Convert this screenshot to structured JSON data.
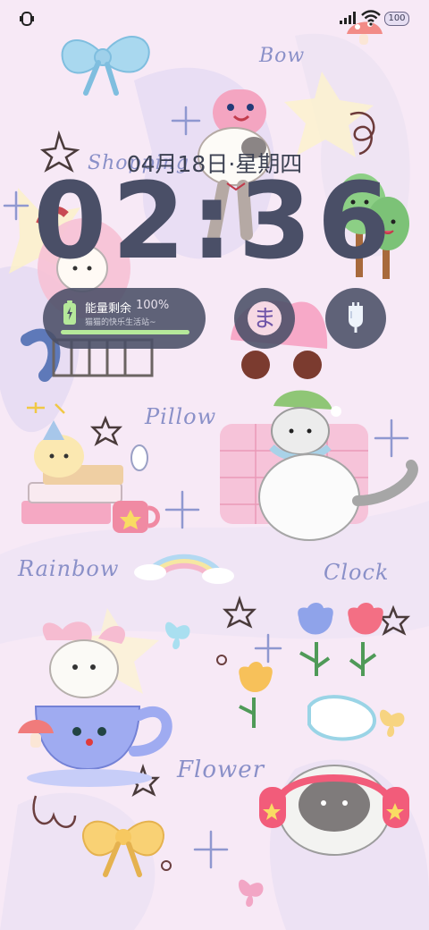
{
  "status_bar": {
    "left_icon": "notification-icon",
    "signal_icon": "signal-bars-icon",
    "wifi_icon": "wifi-icon",
    "battery_level": "100"
  },
  "lockscreen": {
    "date": "04月18日",
    "date_separator": "·",
    "weekday": "星期四",
    "time": "02:36"
  },
  "widgets": {
    "energy": {
      "icon": "battery-charging-icon",
      "title": "能量剩余",
      "percent": "100%",
      "percent_value": 100,
      "subtitle": "猫猫的快乐生活站~",
      "bar_color": "#b5e89a"
    },
    "character_widget": {
      "icon": "hiragana-ma-icon",
      "glyph": "ま"
    },
    "power_widget": {
      "icon": "plug-icon"
    }
  },
  "wallpaper": {
    "words": {
      "bow": "Bow",
      "shopping": "Shopping",
      "pillow": "Pillow",
      "rainbow": "Rainbow",
      "clock": "Clock",
      "flower": "Flower"
    },
    "colors": {
      "background": "#f7e9f6",
      "lilac": "#d9cff0",
      "word": "#8a90c8"
    }
  }
}
